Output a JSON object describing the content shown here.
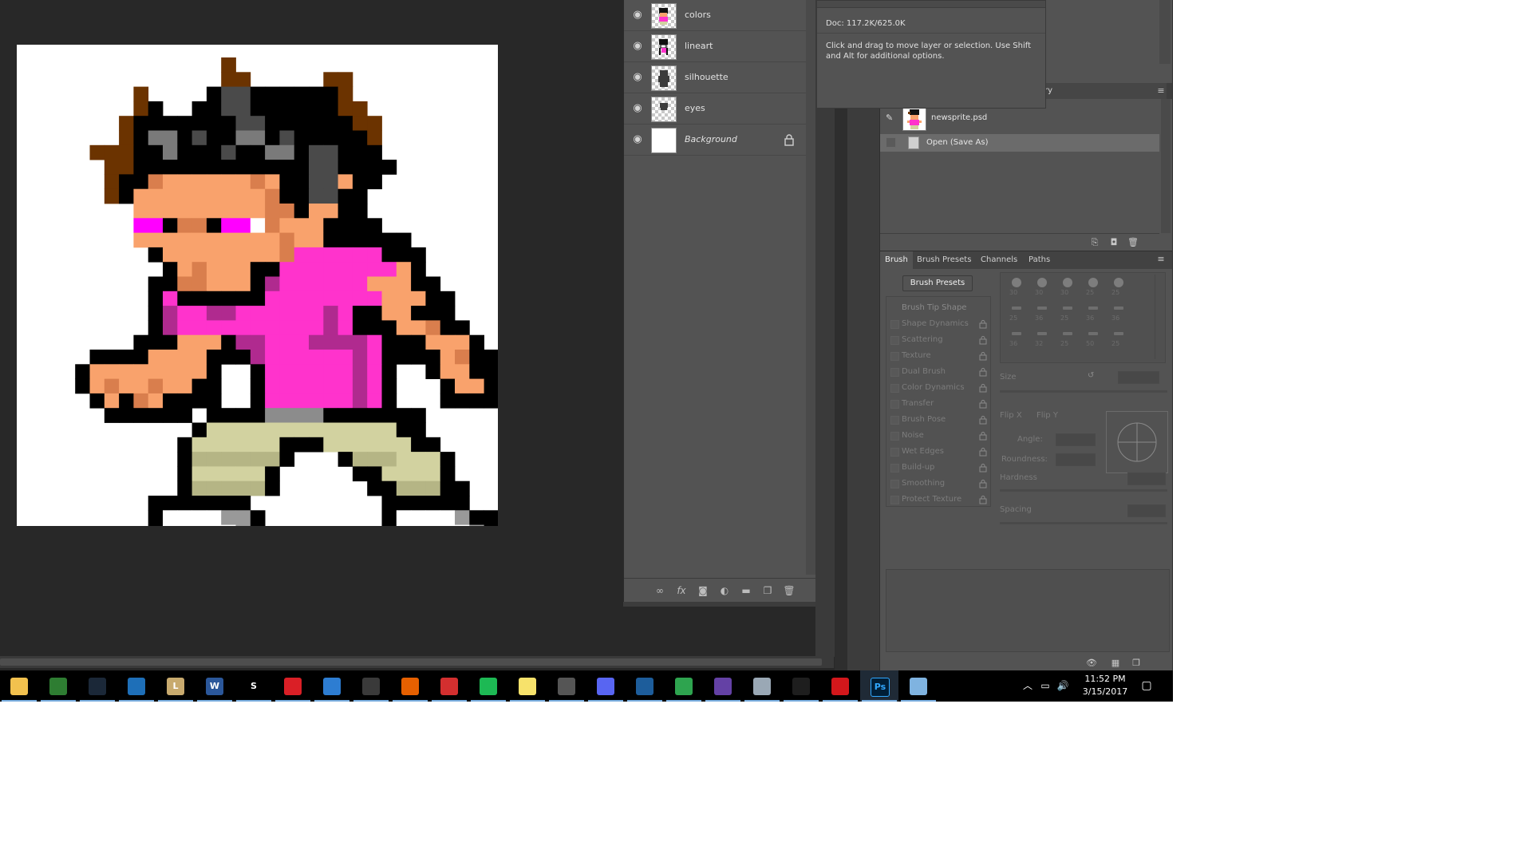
{
  "layers": [
    {
      "name": "colors",
      "italic": false,
      "locked": false
    },
    {
      "name": "lineart",
      "italic": false,
      "locked": false
    },
    {
      "name": "silhouette",
      "italic": false,
      "locked": false
    },
    {
      "name": "eyes",
      "italic": false,
      "locked": false
    },
    {
      "name": "Background",
      "italic": true,
      "locked": true
    }
  ],
  "info": {
    "doc": "Doc: 117.2K/625.0K",
    "help": "Click and drag to move layer or selection.  Use Shift and Alt for additional options."
  },
  "history": {
    "tab_label": "ry",
    "items": [
      {
        "label": "newsprite.psd",
        "type": "snapshot"
      },
      {
        "label": "Open (Save As)",
        "type": "step",
        "selected": true
      }
    ]
  },
  "brush": {
    "tabs": [
      "Brush",
      "Brush Presets",
      "Channels",
      "Paths"
    ],
    "active_tab": "Brush",
    "presets_button": "Brush Presets",
    "options": [
      "Brush Tip Shape",
      "Shape Dynamics",
      "Scattering",
      "Texture",
      "Dual Brush",
      "Color Dynamics",
      "Transfer",
      "Brush Pose",
      "Noise",
      "Wet Edges",
      "Build-up",
      "Smoothing",
      "Protect Texture"
    ],
    "tip_sizes": [
      "30",
      "30",
      "30",
      "25",
      "25",
      "25",
      "36",
      "25",
      "36",
      "36",
      "36",
      "32",
      "25",
      "50",
      "25"
    ],
    "size_label": "Size",
    "flip_x": "Flip X",
    "flip_y": "Flip Y",
    "angle_label": "Angle:",
    "roundness_label": "Roundness:",
    "hardness_label": "Hardness",
    "spacing_label": "Spacing"
  },
  "taskbar": {
    "apps": [
      {
        "name": "file-explorer-icon",
        "color": "#f2c14e",
        "glyph": ""
      },
      {
        "name": "chrome-icon",
        "color": "#2e7d32",
        "glyph": ""
      },
      {
        "name": "steam-icon",
        "color": "#1b2838",
        "glyph": ""
      },
      {
        "name": "app-ship-icon",
        "color": "#1e6fb8",
        "glyph": ""
      },
      {
        "name": "league-icon",
        "color": "#c8aa6e",
        "glyph": "L"
      },
      {
        "name": "word-icon",
        "color": "#2b579a",
        "glyph": "W"
      },
      {
        "name": "app-s-icon",
        "color": "#000000",
        "glyph": "S"
      },
      {
        "name": "creative-cloud-icon",
        "color": "#da1f26",
        "glyph": ""
      },
      {
        "name": "app-blue-square-icon",
        "color": "#2d7dd2",
        "glyph": ""
      },
      {
        "name": "app-window-icon",
        "color": "#3a3a3a",
        "glyph": ""
      },
      {
        "name": "firefox-icon",
        "color": "#e66000",
        "glyph": ""
      },
      {
        "name": "app-red-circle-icon",
        "color": "#d32f2f",
        "glyph": ""
      },
      {
        "name": "app-green-ring-icon",
        "color": "#1db954",
        "glyph": ""
      },
      {
        "name": "sticky-notes-icon",
        "color": "#f7e26b",
        "glyph": ""
      },
      {
        "name": "calculator-icon",
        "color": "#555555",
        "glyph": ""
      },
      {
        "name": "discord-icon",
        "color": "#5865f2",
        "glyph": ""
      },
      {
        "name": "app-chart-icon",
        "color": "#1d5d9b",
        "glyph": ""
      },
      {
        "name": "app-globe-icon",
        "color": "#2ea44f",
        "glyph": ""
      },
      {
        "name": "twitch-icon",
        "color": "#6441a5",
        "glyph": ""
      },
      {
        "name": "app-cloud-icon",
        "color": "#9aa8b5",
        "glyph": ""
      },
      {
        "name": "terminal-icon",
        "color": "#1e1e1e",
        "glyph": ""
      },
      {
        "name": "acrobat-icon",
        "color": "#d3171b",
        "glyph": ""
      },
      {
        "name": "photoshop-icon",
        "color": "#001e36",
        "glyph": "Ps",
        "focused": true
      },
      {
        "name": "app-paint-icon",
        "color": "#7fb3e0",
        "glyph": ""
      }
    ],
    "clock_time": "11:52 PM",
    "clock_date": "3/15/2017"
  },
  "colors": {
    "black": "#000000",
    "hair_brown": "#6b3300",
    "hair_gray": "#4a4a4a",
    "hair_lightgray": "#7a7a7a",
    "skin": "#f9a26c",
    "skin_shadow": "#d97e4d",
    "eye_magenta": "#ff00ff",
    "shirt": "#ff33cc",
    "shirt_shadow": "#b02a8f",
    "belt_gray": "#8c8c8c",
    "pants": "#d2d2a0",
    "pants_shadow": "#b5b585",
    "shoe_gray": "#999999"
  }
}
